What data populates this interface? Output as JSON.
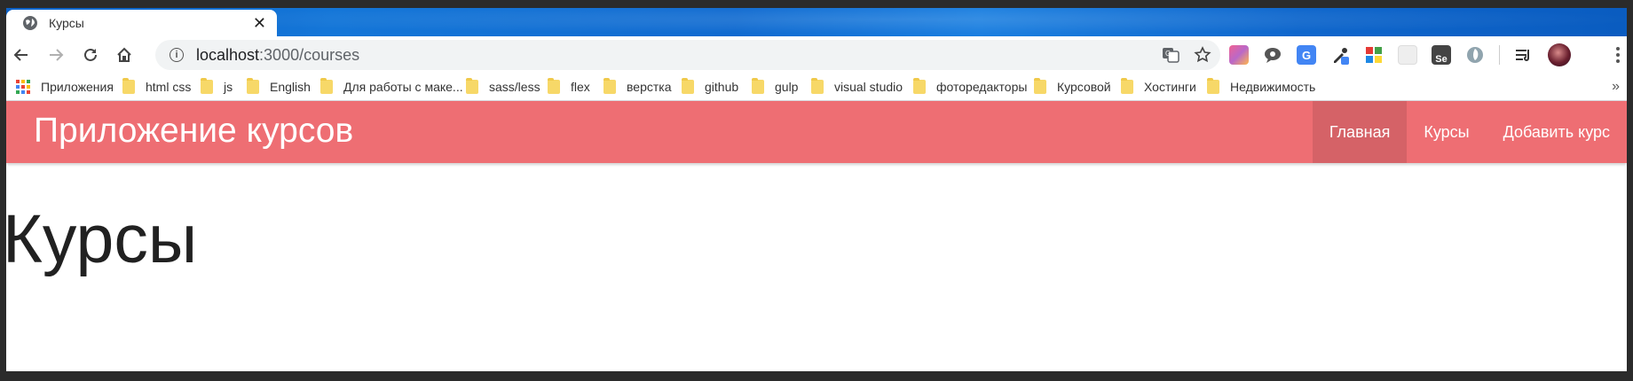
{
  "tab": {
    "title": "Курсы",
    "close": "✕"
  },
  "address_bar": {
    "host": "localhost",
    "path": ":3000/courses"
  },
  "bookmarks": {
    "apps": "Приложения",
    "items": [
      "html css",
      "js",
      "English",
      "Для работы с маке...",
      "sass/less",
      "flex",
      "верстка",
      "github",
      "gulp",
      "visual studio",
      "фоторедакторы",
      "Курсовой",
      "Хостинги",
      "Недвижимость"
    ],
    "more": "»"
  },
  "app": {
    "brand": "Приложение курсов",
    "nav": [
      {
        "label": "Главная",
        "active": true
      },
      {
        "label": "Курсы",
        "active": false
      },
      {
        "label": "Добавить курс",
        "active": false
      }
    ],
    "heading": "Курсы"
  },
  "colors": {
    "navbar": "#ee6e73",
    "tabstrip": "#1476d8",
    "folder": "#f7d868"
  }
}
